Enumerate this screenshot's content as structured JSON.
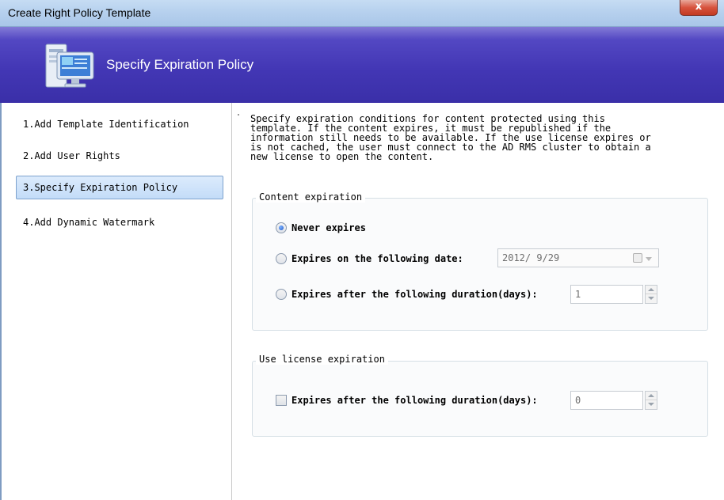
{
  "window": {
    "title": "Create Right Policy Template",
    "close_glyph": "x"
  },
  "header": {
    "heading": "Specify Expiration Policy",
    "icon": "computer-monitor-icon"
  },
  "nav": {
    "items": [
      {
        "label": "1.Add Template Identification",
        "selected": false
      },
      {
        "label": "2.Add User Rights",
        "selected": false
      },
      {
        "label": "3.Specify Expiration Policy",
        "selected": true
      },
      {
        "label": "4.Add Dynamic Watermark",
        "selected": false
      }
    ]
  },
  "description": "Specify expiration conditions for content protected using this\ntemplate. If the content expires, it must be republished if the\ninformation still needs to be available. If the use license expires or\nis not cached, the user must connect to the AD RMS cluster to obtain a\nnew license to open the content.",
  "content_expiration": {
    "legend": "Content expiration",
    "never_label": "Never expires",
    "on_date_label": "Expires on the following date:",
    "date_value": "2012/ 9/29",
    "after_duration_label": "Expires after the following duration(days):",
    "duration_value": "1",
    "selected": "never"
  },
  "use_license_expiration": {
    "legend": "Use license expiration",
    "after_duration_label": "Expires after the following duration(days):",
    "duration_value": "0",
    "checked": false
  },
  "colors": {
    "header_bg": "#4337b5",
    "selected_nav_bg": "#c3dcf8",
    "close_button": "#d7533e"
  }
}
